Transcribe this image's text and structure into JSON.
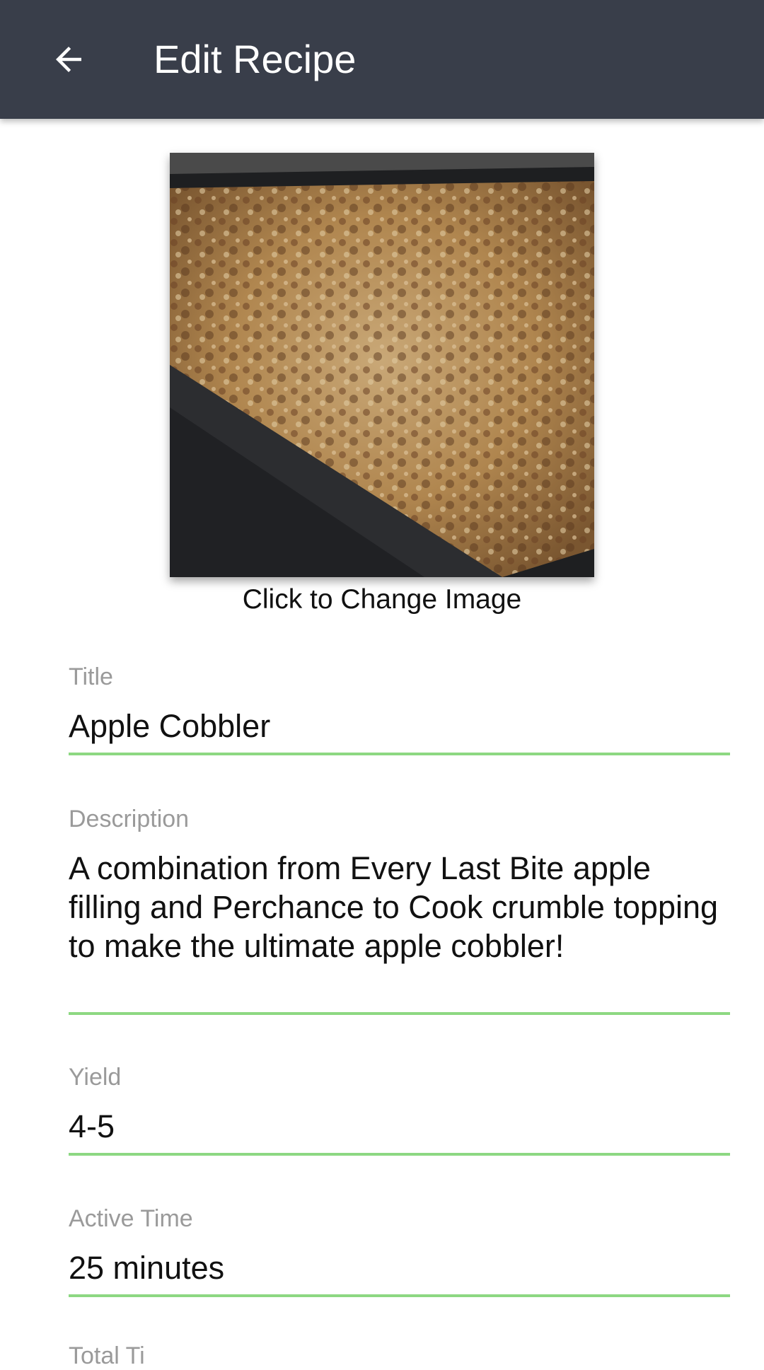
{
  "app_bar": {
    "title": "Edit Recipe",
    "back_icon": "arrow-left-icon",
    "background": "#393e4a"
  },
  "image": {
    "caption": "Click to Change Image"
  },
  "fields": [
    {
      "label": "Title",
      "value": "Apple Cobbler"
    },
    {
      "label": "Description",
      "value": "A combination from Every Last Bite apple filling and Perchance to Cook crumble topping to make the ultimate apple cobbler!"
    },
    {
      "label": "Yield",
      "value": "4-5"
    },
    {
      "label": "Active Time",
      "value": "25 minutes"
    }
  ],
  "next_field_label_partial": "Total Ti",
  "colors": {
    "underline": "#8dd882",
    "label": "#9a9a9a",
    "text": "#111111"
  }
}
